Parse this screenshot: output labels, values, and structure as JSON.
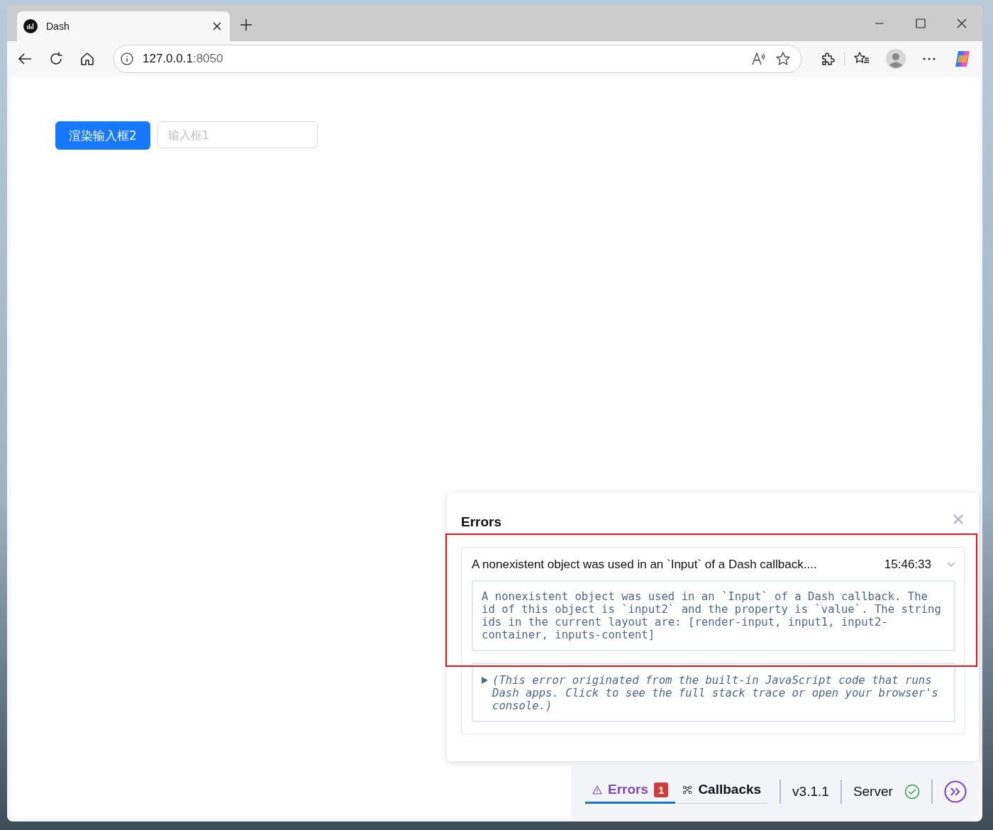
{
  "browser": {
    "tab": {
      "title": "Dash"
    },
    "address": {
      "host": "127.0.0.1",
      "port": ":8050"
    }
  },
  "app": {
    "button": "渲染输入框2",
    "input": {
      "placeholder": "输入框1"
    }
  },
  "errors_panel": {
    "title": "Errors",
    "items": [
      {
        "summary": "A nonexistent object was used in an `Input` of a Dash callback....",
        "time": "15:46:33",
        "message": "A nonexistent object was used in an `Input` of a Dash callback. The id of this object is `input2` and the property is `value`. The string ids in the current layout are: [render-input, input1, input2-container, inputs-content]",
        "stack_note": "(This error originated from the built-in JavaScript code that runs Dash apps. Click to see the full stack trace or open your browser's console.)"
      }
    ]
  },
  "devtools": {
    "tabs": [
      {
        "label": "Errors",
        "count": "1",
        "selected": true,
        "kind": "errors"
      },
      {
        "label": "Callbacks",
        "selected": false,
        "kind": "callbacks"
      }
    ],
    "version": "v3.1.1",
    "server": "Server"
  }
}
